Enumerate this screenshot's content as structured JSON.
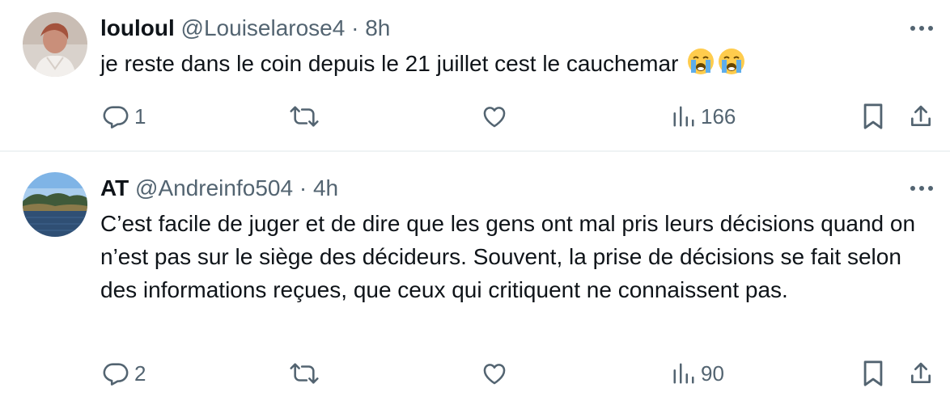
{
  "tweets": [
    {
      "name": "louloul",
      "handle": "@Louiselarose4",
      "separator": "·",
      "time": "8h",
      "text": "je reste dans le coin depuis le 21 juillet cest le cauchemar",
      "emojis": [
        "loudly-crying-face",
        "loudly-crying-face"
      ],
      "replies": "1",
      "reposts": "",
      "likes": "",
      "views": "166"
    },
    {
      "name": "AT",
      "handle": "@Andreinfo504",
      "separator": "·",
      "time": "4h",
      "text": "C’est facile de juger et de dire que les gens ont mal pris leurs décisions quand on n’est pas sur le siège des décideurs. Souvent, la prise de décisions se fait selon des informations reçues, que ceux qui critiquent ne connaissent pas.",
      "replies": "2",
      "reposts": "",
      "likes": "",
      "views": "90"
    }
  ],
  "icons": {
    "more": "more-dots-icon",
    "reply": "reply-bubble-icon",
    "repost": "repost-arrows-icon",
    "like": "heart-icon",
    "views": "views-bar-chart-icon",
    "bookmark": "bookmark-icon",
    "share": "share-upload-icon"
  },
  "colors": {
    "text_primary": "#0f1419",
    "text_secondary": "#536471",
    "divider": "#eff3f4"
  }
}
